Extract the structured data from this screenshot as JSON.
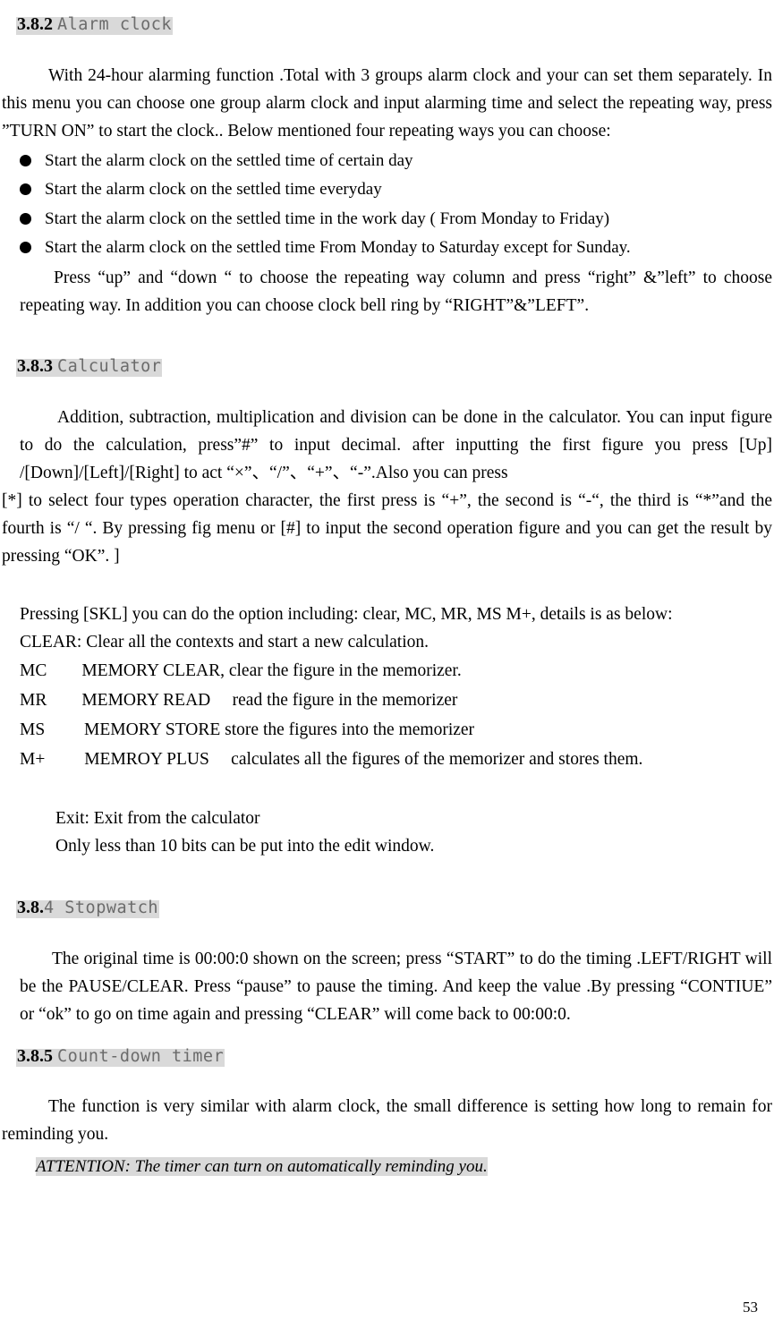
{
  "document": {
    "page_number": "53",
    "highlight_color": "#d9d9d9",
    "heading_name_color": "#6b6b6b"
  },
  "sections": [
    {
      "id": "alarm-clock",
      "number": "3.8.2 ",
      "name": "Alarm clock",
      "intro": "With 24-hour alarming function .Total with 3 groups alarm clock and your can set them separately. In this menu you can choose one group alarm clock and input alarming time and select the repeating way, press ”TURN ON” to start the clock.. Below mentioned four repeating ways you can choose:",
      "bullets": [
        "Start the alarm clock on the settled time of certain day",
        "Start the alarm clock on the settled time everyday",
        "Start the alarm clock on the settled time in the work day ( From Monday to Friday)",
        "Start the alarm clock on the settled time From Monday to Saturday except for Sunday."
      ],
      "outro": "Press “up” and “down “ to choose the repeating way column and press “right” &”left” to choose repeating way. In addition you can choose clock bell ring by “RIGHT”&”LEFT”."
    },
    {
      "id": "calculator",
      "number": "3.8.3 ",
      "name": "Calculator",
      "para1": "Addition, subtraction, multiplication and division can be done in the calculator. You can input figure to do the calculation, press”#” to input decimal. after inputting the first figure you press [Up] /[Down]/[Left]/[Right] to act “×”、“/”、“+”、“-”.Also you can press",
      "para2": "[*] to select four types operation character, the first press is “+”, the second is “-“, the third is “*”and the fourth is “/ “. By pressing fig menu or [#] to input the second operation figure and you can get the result by pressing “OK”. ]",
      "skl_line": "Pressing [SKL] you can do the option including: clear, MC, MR, MS M+, details is as below:",
      "clear_line": "CLEAR: Clear all the contexts and start a new calculation.",
      "memory_lines": [
        "MC        MEMORY CLEAR, clear the figure in the memorizer.",
        "MR        MEMORY READ     read the figure in the memorizer",
        "MS         MEMORY STORE store the figures into the memorizer",
        "M+         MEMROY PLUS     calculates all the figures of the memorizer and stores them."
      ],
      "exit_line": "Exit: Exit from the calculator",
      "bits_line": "Only less than 10 bits can be put into the edit window."
    },
    {
      "id": "stopwatch",
      "number": "3.8.",
      "number_tail": "4 ",
      "name": "Stopwatch",
      "para1": "The original time is 00:00:0 shown on the screen; press “START” to do the timing .LEFT/RIGHT will be the PAUSE/CLEAR. Press “pause” to pause the timing. And keep the value .By pressing “CONTIUE” or “ok” to go on time again and pressing “CLEAR” will come back to 00:00:0."
    },
    {
      "id": "countdown-timer",
      "number": "3.8.5 ",
      "name": "Count-down timer",
      "para1": "The function is very similar with alarm clock, the small difference is setting how long to remain for reminding you.",
      "attention": "ATTENTION: The timer can turn on automatically reminding you."
    }
  ]
}
